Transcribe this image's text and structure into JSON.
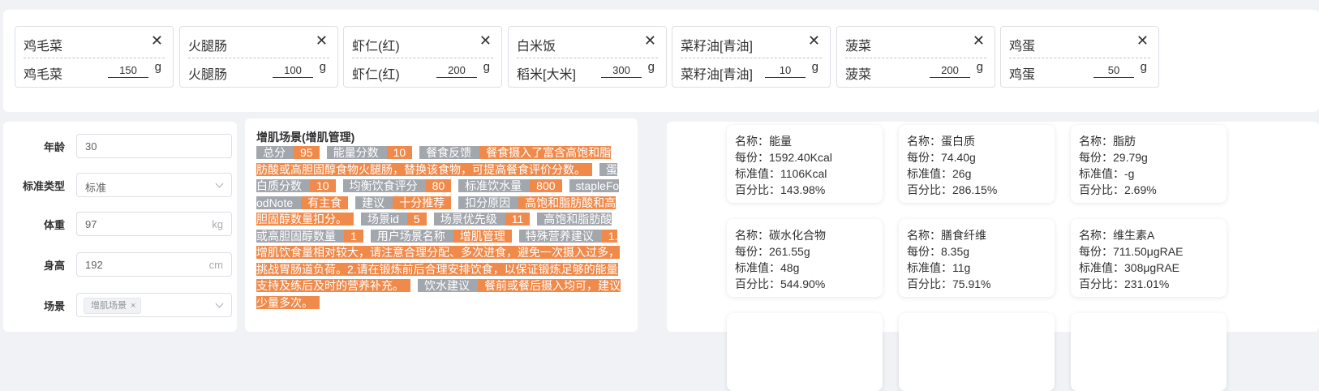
{
  "foods": [
    {
      "title": "鸡毛菜",
      "ingredient": "鸡毛菜",
      "qty": "150",
      "unit": "g"
    },
    {
      "title": "火腿肠",
      "ingredient": "火腿肠",
      "qty": "100",
      "unit": "g"
    },
    {
      "title": "虾仁(红)",
      "ingredient": "虾仁(红)",
      "qty": "200",
      "unit": "g"
    },
    {
      "title": "白米饭",
      "ingredient": "稻米[大米]",
      "qty": "300",
      "unit": "g"
    },
    {
      "title": "菜籽油[青油]",
      "ingredient": "菜籽油[青油]",
      "qty": "10",
      "unit": "g"
    },
    {
      "title": "菠菜",
      "ingredient": "菠菜",
      "qty": "200",
      "unit": "g"
    },
    {
      "title": "鸡蛋",
      "ingredient": "鸡蛋",
      "qty": "50",
      "unit": "g"
    }
  ],
  "close_glyph": "✕",
  "form": {
    "age": {
      "label": "年龄",
      "value": "30"
    },
    "standard": {
      "label": "标准类型",
      "value": "标准"
    },
    "weight": {
      "label": "体重",
      "value": "97",
      "suffix": "kg"
    },
    "height": {
      "label": "身高",
      "value": "192",
      "suffix": "cm"
    },
    "scene": {
      "label": "场景",
      "tag": "增肌场景",
      "tag_close": "×"
    }
  },
  "scene": {
    "title": "增肌场景(增肌管理)",
    "items": [
      {
        "k": "总分",
        "v": "95"
      },
      {
        "k": "能量分数",
        "v": "10"
      },
      {
        "k": "餐食反馈",
        "v": "餐食摄入了富含高饱和脂肪酸或高胆固醇食物火腿肠，替换该食物，可提高餐食评价分数。"
      },
      {
        "k": "蛋白质分数",
        "v": "10"
      },
      {
        "k": "均衡饮食评分",
        "v": "80"
      },
      {
        "k": "标准饮水量",
        "v": "800"
      },
      {
        "k": "stapleFoodNote",
        "v": "有主食"
      },
      {
        "k": "建议",
        "v": "十分推荐"
      },
      {
        "k": "扣分原因",
        "v": "高饱和脂肪酸和高胆固醇数量扣分。"
      },
      {
        "k": "场景id",
        "v": "5"
      },
      {
        "k": "场景优先级",
        "v": "11"
      },
      {
        "k": "高饱和脂肪酸或高胆固醇数量",
        "v": "1"
      },
      {
        "k": "用户场景名称",
        "v": "增肌管理"
      },
      {
        "k": "特殊营养建议",
        "v": "1.增肌饮食量相对较大，请注意合理分配、多次进食，避免一次摄入过多，挑战胃肠道负荷。2.请在锻炼前后合理安排饮食，以保证锻炼足够的能量支持及练后及时的营养补充。"
      },
      {
        "k": "饮水建议",
        "v": "餐前或餐后摄入均可，建议少量多次。"
      }
    ]
  },
  "nutrients": [
    {
      "name": "名称：能量",
      "per": "每份：1592.40Kcal",
      "std": "标准值：1106Kcal",
      "pct": "百分比：143.98%"
    },
    {
      "name": "名称：蛋白质",
      "per": "每份：74.40g",
      "std": "标准值：26g",
      "pct": "百分比：286.15%"
    },
    {
      "name": "名称：脂肪",
      "per": "每份：29.79g",
      "std": "标准值：-g",
      "pct": "百分比：2.69%"
    },
    {
      "name": "名称：碳水化合物",
      "per": "每份：261.55g",
      "std": "标准值：48g",
      "pct": "百分比：544.90%"
    },
    {
      "name": "名称：膳食纤维",
      "per": "每份：8.35g",
      "std": "标准值：11g",
      "pct": "百分比：75.91%"
    },
    {
      "name": "名称：维生素A",
      "per": "每份：711.50μgRAE",
      "std": "标准值：308μgRAE",
      "pct": "百分比：231.01%"
    },
    {
      "name": "",
      "per": "",
      "std": "",
      "pct": ""
    },
    {
      "name": "",
      "per": "",
      "std": "",
      "pct": ""
    },
    {
      "name": "",
      "per": "",
      "std": "",
      "pct": ""
    }
  ]
}
